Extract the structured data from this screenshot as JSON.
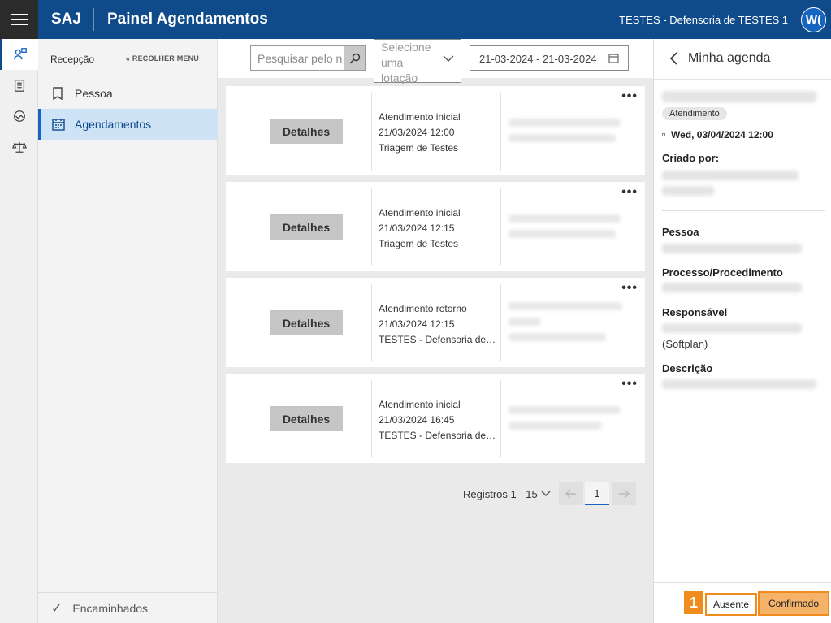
{
  "header": {
    "brand": "SAJ",
    "title": "Painel Agendamentos",
    "org": "TESTES - Defensoria de TESTES 1",
    "avatar_initials": "W("
  },
  "sidebar": {
    "section": "Recepção",
    "collapse_label": "RECOLHER MENU",
    "items": [
      {
        "label": "Pessoa"
      },
      {
        "label": "Agendamentos"
      }
    ],
    "footer_label": "Encaminhados"
  },
  "filters": {
    "search_placeholder": "Pesquisar pelo n",
    "select_placeholder": "Selecione uma lotação",
    "date_range": "21-03-2024 - 21-03-2024"
  },
  "cards": [
    {
      "button": "Detalhes",
      "type": "Atendimento inicial",
      "datetime": "21/03/2024 12:00",
      "location": "Triagem de Testes"
    },
    {
      "button": "Detalhes",
      "type": "Atendimento inicial",
      "datetime": "21/03/2024 12:15",
      "location": "Triagem de Testes"
    },
    {
      "button": "Detalhes",
      "type": "Atendimento retorno",
      "datetime": "21/03/2024 12:15",
      "location": "TESTES - Defensoria de ..."
    },
    {
      "button": "Detalhes",
      "type": "Atendimento inicial",
      "datetime": "21/03/2024 16:45",
      "location": "TESTES - Defensoria de ..."
    }
  ],
  "pagination": {
    "records": "Registros 1 - 15",
    "current_page": "1"
  },
  "panel": {
    "title": "Minha agenda",
    "badge": "Atendimento",
    "date": "Wed, 03/04/2024 12:00",
    "created_by_label": "Criado por:",
    "pessoa_label": "Pessoa",
    "processo_label": "Processo/Procedimento",
    "responsavel_label": "Responsável",
    "responsavel_suffix": "(Softplan)",
    "descricao_label": "Descrição",
    "step_number": "1",
    "ausente_label": "Ausente",
    "confirmado_label": "Confirmado"
  },
  "colors": {
    "header_bg": "#0f4a8a",
    "accent": "#1565c0",
    "highlight": "#f08c1e",
    "confirm_bg": "#f5b36a"
  }
}
